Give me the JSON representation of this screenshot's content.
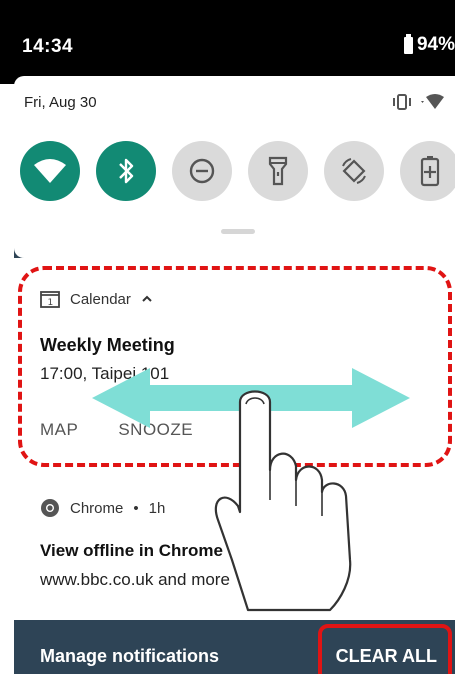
{
  "status_bar": {
    "time": "14:34",
    "battery": "94%"
  },
  "quick_settings": {
    "date": "Fri, Aug 30",
    "tiles": [
      {
        "name": "wifi",
        "active": true
      },
      {
        "name": "bluetooth",
        "active": true
      },
      {
        "name": "do-not-disturb",
        "active": false
      },
      {
        "name": "flashlight",
        "active": false
      },
      {
        "name": "auto-rotate",
        "active": false
      },
      {
        "name": "battery-saver",
        "active": false
      }
    ]
  },
  "notifications": [
    {
      "app": "Calendar",
      "title": "Weekly Meeting",
      "body": "17:00, Taipei 101",
      "actions": [
        "MAP",
        "SNOOZE"
      ]
    },
    {
      "app": "Chrome",
      "time": "1h",
      "title": "View offline in Chrome",
      "body": "www.bbc.co.uk and more"
    }
  ],
  "bottom_bar": {
    "manage_label": "Manage notifications",
    "clear_label": "CLEAR ALL"
  },
  "colors": {
    "tile_active": "#128a74",
    "tile_inactive": "#dadada",
    "shade": "#2e4456",
    "highlight": "#e01414",
    "swipe_arrow": "#7fded6"
  },
  "icons": [
    "battery-icon",
    "vibrate-icon",
    "wifi-signal-icon",
    "calendar-icon",
    "expand-chevron-icon",
    "chrome-icon",
    "hand-swipe-icon"
  ]
}
